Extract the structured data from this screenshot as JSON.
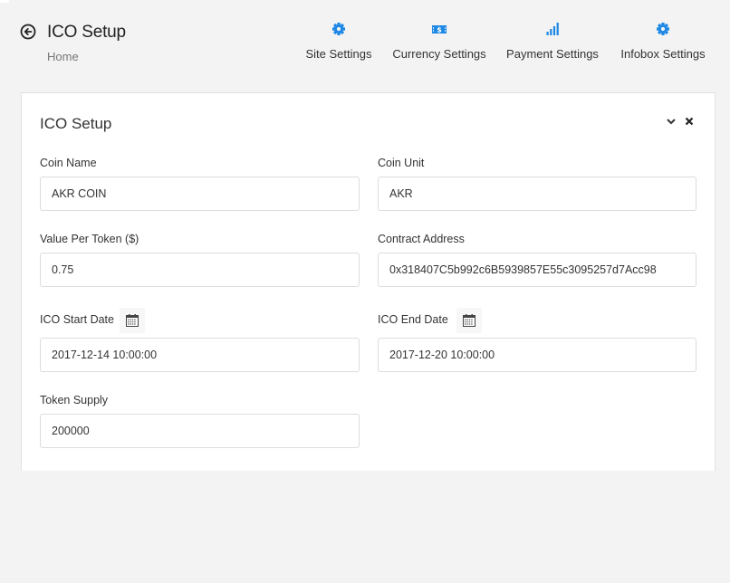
{
  "header": {
    "title": "ICO Setup",
    "breadcrumb": "Home",
    "back_icon": "arrow-left-circle-icon"
  },
  "nav": [
    {
      "label": "Site Settings",
      "icon": "gear-icon"
    },
    {
      "label": "Currency Settings",
      "icon": "money-bill-icon"
    },
    {
      "label": "Payment Settings",
      "icon": "signal-bars-icon"
    },
    {
      "label": "Infobox Settings",
      "icon": "gear-icon"
    }
  ],
  "colors": {
    "accent": "#1e88e5",
    "background": "#f3f3f3",
    "card": "#ffffff",
    "border": "#dddddd"
  },
  "card": {
    "title": "ICO Setup",
    "collapse_icon": "chevron-down-icon",
    "close_icon": "close-icon",
    "fields": {
      "coin_name": {
        "label": "Coin Name",
        "value": "AKR COIN"
      },
      "coin_unit": {
        "label": "Coin Unit",
        "value": "AKR"
      },
      "value_per_token": {
        "label": "Value Per Token ($)",
        "value": "0.75"
      },
      "contract_address": {
        "label": "Contract Address",
        "value": "0x318407C5b992c6B5939857E55c3095257d7Acc98"
      },
      "start_date": {
        "label": "ICO Start Date",
        "value": "2017-12-14 10:00:00",
        "icon": "calendar-icon"
      },
      "end_date": {
        "label": "ICO End Date",
        "value": "2017-12-20 10:00:00",
        "icon": "calendar-icon"
      },
      "token_supply": {
        "label": "Token Supply",
        "value": "200000"
      }
    }
  }
}
